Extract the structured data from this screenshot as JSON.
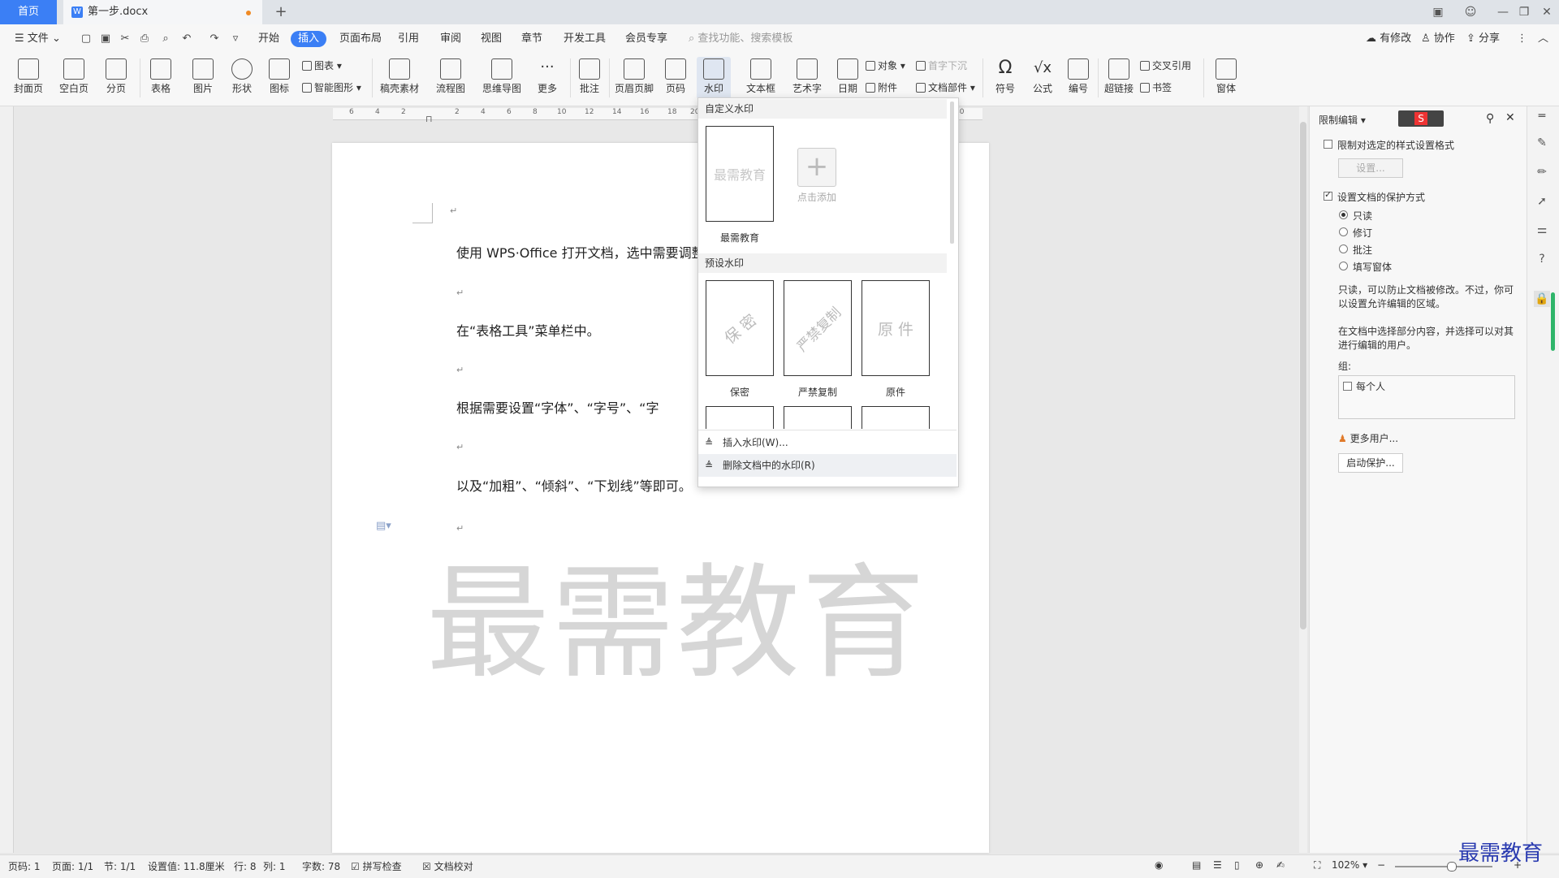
{
  "tabs": {
    "home": "首页",
    "doc_name": "第一步.docx",
    "doc_icon": "W"
  },
  "menu": {
    "file": "文件",
    "items": [
      "开始",
      "插入",
      "页面布局",
      "引用",
      "审阅",
      "视图",
      "章节",
      "开发工具",
      "会员专享"
    ],
    "active": "插入",
    "search_placeholder": "查找功能、搜索模板",
    "right": {
      "modified": "有修改",
      "collab": "协作",
      "share": "分享"
    }
  },
  "ribbon": {
    "cover": "封面页",
    "blank": "空白页",
    "pagebreak": "分页",
    "table": "表格",
    "picture": "图片",
    "shape": "形状",
    "iconlib": "图标",
    "chart": "图表",
    "smartart": "智能图形",
    "material": "稿壳素材",
    "flow": "流程图",
    "mind": "思维导图",
    "more": "更多",
    "comment": "批注",
    "headerfooter": "页眉页脚",
    "pagenum": "页码",
    "watermark": "水印",
    "textbox": "文本框",
    "wordart": "艺术字",
    "date": "日期",
    "object": "对象",
    "attachment": "附件",
    "dropcap": "首字下沉",
    "docpart": "文档部件",
    "symbol": "符号",
    "formula": "公式",
    "numbering": "编号",
    "hyperlink": "超链接",
    "crossref": "交叉引用",
    "bookmark": "书签",
    "window": "窗体"
  },
  "ruler_labels": [
    "6",
    "4",
    "2",
    "2",
    "4",
    "6",
    "8",
    "10",
    "12",
    "14",
    "16",
    "18",
    "20",
    "40"
  ],
  "document": {
    "p1": "使用 WPS·Office 打开文档，选中需要调整",
    "p2": "在“表格工具”菜单栏中。",
    "p3": "根据需要设置“字体”、“字号”、“字",
    "p4": "以及“加粗”、“倾斜”、“下划线”等即可。",
    "para_mark": "↵",
    "watermark_text": "最需教育"
  },
  "watermark_menu": {
    "custom_title": "自定义水印",
    "custom_item": "最需教育",
    "add_label": "点击添加",
    "preset_title": "预设水印",
    "presets": [
      {
        "label": "保密",
        "text": "保 密"
      },
      {
        "label": "严禁复制",
        "text": "严禁复制"
      },
      {
        "label": "原件",
        "text": "原 件"
      }
    ],
    "insert_action": "插入水印(W)...",
    "delete_action": "删除文档中的水印(R)"
  },
  "restrict_panel": {
    "title": "限制编辑",
    "limit_format": "限制对选定的样式设置格式",
    "settings_btn": "设置...",
    "protect_mode": "设置文档的保护方式",
    "modes": [
      "只读",
      "修订",
      "批注",
      "填写窗体"
    ],
    "selected_mode": "只读",
    "desc1_line1": "只读，可以防止文档被修改。不过，你可",
    "desc1_line2": "以设置允许编辑的区域。",
    "desc2_line1": "在文档中选择部分内容，并选择可以对其",
    "desc2_line2": "进行编辑的用户。",
    "group_label": "组:",
    "everyone": "每个人",
    "more_users": "更多用户...",
    "start_btn": "启动保护..."
  },
  "status": {
    "page_num": "页码: 1",
    "pages": "页面: 1/1",
    "section": "节: 1/1",
    "setting": "设置值: 11.8厘米",
    "row": "行: 8",
    "col": "列: 1",
    "words": "字数: 78",
    "spell": "拼写检查",
    "proof": "文档校对",
    "zoom": "102%"
  },
  "corner_logo": "最需教育",
  "colors": {
    "accent": "#3b7ff5",
    "watermark_gray": "#d6d6d6",
    "logo_blue": "#2a3bb0"
  }
}
